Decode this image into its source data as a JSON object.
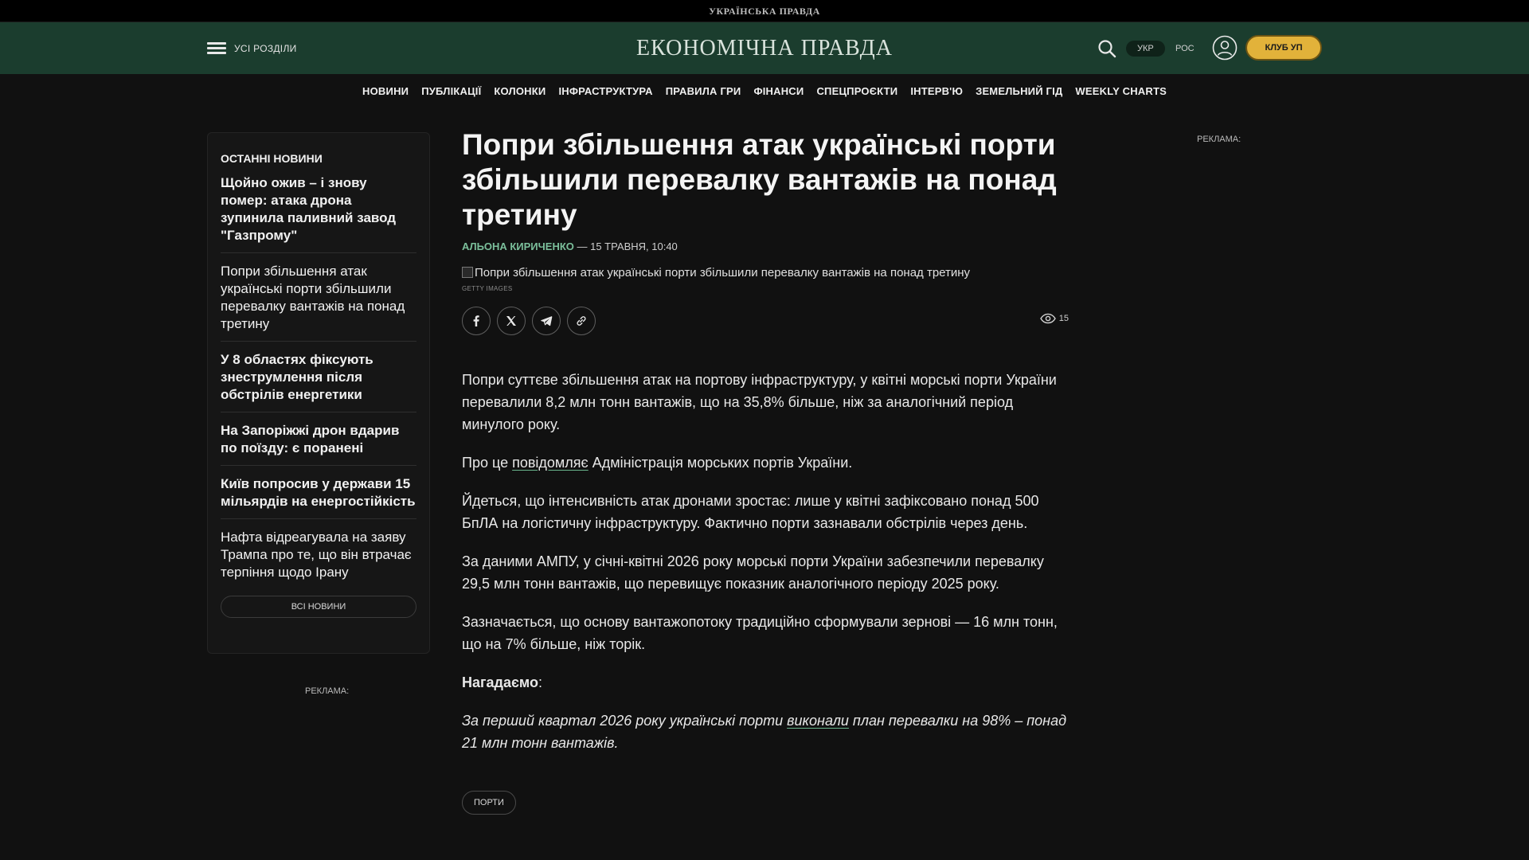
{
  "top_strip": {
    "brand": "УКРАЇНСЬКА ПРАВДА"
  },
  "header": {
    "menu_label": "УСІ РОЗДІЛИ",
    "logo": "ЕКОНОМІЧНА ПРАВДА",
    "lang_ukr": "УКР",
    "lang_ros": "РОС",
    "club_label": "КЛУБ УП",
    "accent_color": "#1b3d2e",
    "club_color": "#e2b23a"
  },
  "nav": [
    "НОВИНИ",
    "ПУБЛІКАЦІЇ",
    "КОЛОНКИ",
    "ІНФРАСТРУКТУРА",
    "ПРАВИЛА ГРИ",
    "ФІНАНСИ",
    "СПЕЦПРОЄКТИ",
    "ІНТЕРВ'Ю",
    "ЗЕМЕЛЬНИЙ ГІД",
    "WEEKLY CHARTS"
  ],
  "sidebar": {
    "title": "ОСТАННІ НОВИНИ",
    "items": [
      {
        "text": "Щойно ожив – і знову помер: атака дрона зупинила паливний завод \"Газпрому\"",
        "bold": true
      },
      {
        "text": "Попри збільшення атак українські порти збільшили перевалку вантажів на понад третину",
        "bold": false
      },
      {
        "text": "У 8 областях фіксують знеструмлення після обстрілів енергетики",
        "bold": true
      },
      {
        "text": "На Запоріжжі дрон вдарив по поїзду: є поранені",
        "bold": true
      },
      {
        "text": "Київ попросив у держави 15 мільярдів на енергостійкість",
        "bold": true
      },
      {
        "text": "Нафта відреагувала на заяву Трампа про те, що він втрачає терпіння щодо Ірану",
        "bold": false
      }
    ],
    "all_news": "ВСІ НОВИНИ",
    "ad_label": "РЕКЛАМА:"
  },
  "right_ad_label": "РЕКЛАМА:",
  "article": {
    "title": "Попри збільшення атак українські порти збільшили перевалку вантажів на понад третину",
    "author": "АЛЬОНА КИРИЧЕНКО",
    "date": " — 15 ТРАВНЯ, 10:40",
    "image_alt": "Попри збільшення атак українські порти збільшили перевалку вантажів на понад третину",
    "image_credit": "GETTY IMAGES",
    "views": "15",
    "p1": "Попри суттєве збільшення атак на портову інфраструктуру, у квітні морські порти України перевалили 8,2 млн тонн вантажів, що на 35,8% більше, ніж за аналогічний період минулого року.",
    "p2_before": "Про це ",
    "p2_link": "повідомляє",
    "p2_after": " Адміністрація морських портів України.",
    "p3": "Йдеться, що інтенсивність атак дронами зростає: лише у квітні зафіксовано понад 500 БпЛА на логістичну інфраструктуру. Фактично порти зазнавали обстрілів через день.",
    "p4": "За даними АМПУ, у січні-квітні 2026 року морські порти України забезпечили перевалку 29,5 млн тонн вантажів, що перевищує показник аналогічного періоду 2025 року.",
    "p5": "Зазначається, що основу вантажопотоку традиційно сформували зернові — 16 млн тонн, що на 7% більше, ніж торік.",
    "remind": "Нагадаємо",
    "remind_colon": ":",
    "p6_before": "За перший квартал 2026 року українські порти ",
    "p6_link": "виконали",
    "p6_after": " план перевалки на 98% – понад 21 млн тонн вантажів.",
    "tag": "ПОРТИ"
  }
}
